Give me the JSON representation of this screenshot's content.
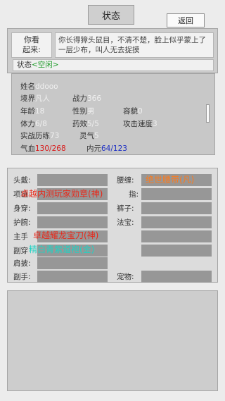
{
  "header": {
    "title": "状态",
    "back_label": "返回"
  },
  "description": {
    "label_line1": "你看",
    "label_line2": "起来:",
    "text": "你长得獐头鼠目，不清不楚，脸上似乎蒙上了一层少布，叫人无去捉摸"
  },
  "state": {
    "prefix": "状态",
    "value": "<空闲>"
  },
  "stats": {
    "name_label": "姓名",
    "name_value": "ddooo",
    "realm_label": "境界",
    "realm_value": "凡人",
    "power_label": "战力",
    "power_value": "366",
    "age_label": "年龄",
    "age_value": "18",
    "gender_label": "性别",
    "gender_value": "男",
    "looks_label": "容貌",
    "looks_value": "0",
    "stamina_label": "体力",
    "stamina_value": "6/8",
    "medicine_label": "药效",
    "medicine_value": "5/5",
    "atkspeed_label": "攻击速度",
    "atkspeed_value": "3",
    "training_label": "实战历练",
    "training_value": "73",
    "spirit_label": "灵气",
    "spirit_value": "5",
    "hp_label": "气血",
    "hp_value": "130/268",
    "inner_label": "内元",
    "inner_value": "64/123"
  },
  "equipment": {
    "head_label": "头戴:",
    "neck_label": "项链",
    "neck_item": "卓越内测玩家勋章(神)",
    "body_label": "身穿:",
    "wrist_label": "护腕:",
    "mainhand_label": "主手",
    "mainhand_item": "卓越耀龙宝刀(神)",
    "offhand_label": "副穿",
    "offhand_item": "精白青紫道袍(金)",
    "shoulder_label": "肩披:",
    "secondary_label": "副手:",
    "waist_label": "腰缠:",
    "waist_item": "绝世腰带(凡)",
    "ring_label": "指:",
    "pants_label": "裤子:",
    "treasure_label": "法宝:",
    "pet_label": "宠物:"
  },
  "colors": {
    "red_item": "#e8281a",
    "orange_item": "#ff7a1a",
    "gold_item": "#8e1fd6",
    "cyan_item": "#1ed3c4"
  }
}
